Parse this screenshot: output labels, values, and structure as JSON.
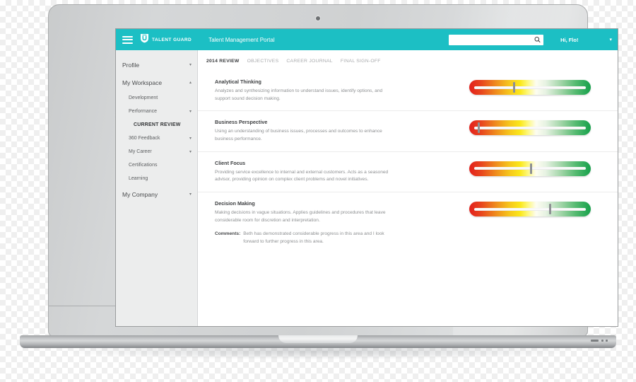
{
  "app": {
    "brand_name": "TALENT GUARD",
    "portal_title": "Talent Management Portal",
    "logo_icon": "shield-u-icon",
    "menu_icon": "hamburger-menu-icon",
    "accent_color": "#1CBFC4"
  },
  "search": {
    "value": "",
    "placeholder": "",
    "icon": "search-icon"
  },
  "user": {
    "greeting": "Hi, Flo!",
    "caret_icon": "chevron-down-icon"
  },
  "sidebar": {
    "items": [
      {
        "label": "Profile",
        "level": "top",
        "caret": "▾"
      },
      {
        "label": "My Workspace",
        "level": "top",
        "caret": "▴"
      },
      {
        "label": "Development",
        "level": "sub",
        "caret": ""
      },
      {
        "label": "Performance",
        "level": "sub",
        "caret": "▾"
      },
      {
        "label": "CURRENT REVIEW",
        "level": "current",
        "caret": ""
      },
      {
        "label": "360 Feedback",
        "level": "sub",
        "caret": "▾"
      },
      {
        "label": "My Career",
        "level": "sub",
        "caret": "▾"
      },
      {
        "label": "Certifications",
        "level": "sub",
        "caret": ""
      },
      {
        "label": "Learning",
        "level": "sub",
        "caret": ""
      },
      {
        "label": "My Company",
        "level": "top",
        "caret": "▾"
      }
    ]
  },
  "tabs": [
    {
      "label": "2014 REVIEW",
      "active": true
    },
    {
      "label": "OBJECTIVES",
      "active": false
    },
    {
      "label": "CAREER JOURNAL",
      "active": false
    },
    {
      "label": "FINAL SIGN-OFF",
      "active": false
    }
  ],
  "competencies": [
    {
      "title": "Analytical Thinking",
      "description": "Analyzes and synthesizing information to understand issues, identify options, and support sound decision making.",
      "rating_percent": 36
    },
    {
      "title": "Business Perspective",
      "description": "Using an understanding of business issues, processes and outcomes to enhance business performance.",
      "rating_percent": 4
    },
    {
      "title": "Client Focus",
      "description": "Providing service excellence to internal and external customers. Acts as a seasoned advisor, providing opinion on complex client problems and novel initiatives.",
      "rating_percent": 51
    },
    {
      "title": "Decision Making",
      "description": "Making decisions in vague situations. Applies guidelines and procedures that leave considerable room for discretion and interpretation.",
      "rating_percent": 68,
      "comments_label": "Comments:",
      "comments_text": "Beth has demonstrated considerable progress in this area and I look forward to further progress in this area."
    }
  ]
}
